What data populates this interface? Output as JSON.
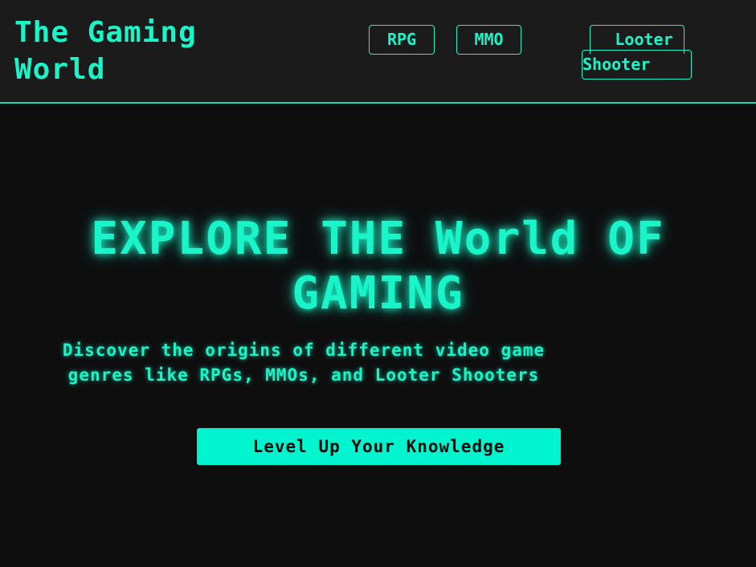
{
  "header": {
    "logo": "The Gaming World",
    "nav": [
      {
        "label": "RPG"
      },
      {
        "label": "MMO"
      },
      {
        "label_line1": "Looter",
        "label_line2": "Shooter"
      }
    ]
  },
  "hero": {
    "title": "EXPLORE THE World OF GAMING",
    "subtitle": "Discover the origins of different video game genres like RPGs, MMOs, and Looter Shooters",
    "cta_label": "Level Up Your Knowledge"
  },
  "colors": {
    "accent": "#19f5c8",
    "cta_bg": "#00f5cf",
    "header_bg": "#1b1b1c",
    "page_bg": "#0e0e0f"
  }
}
